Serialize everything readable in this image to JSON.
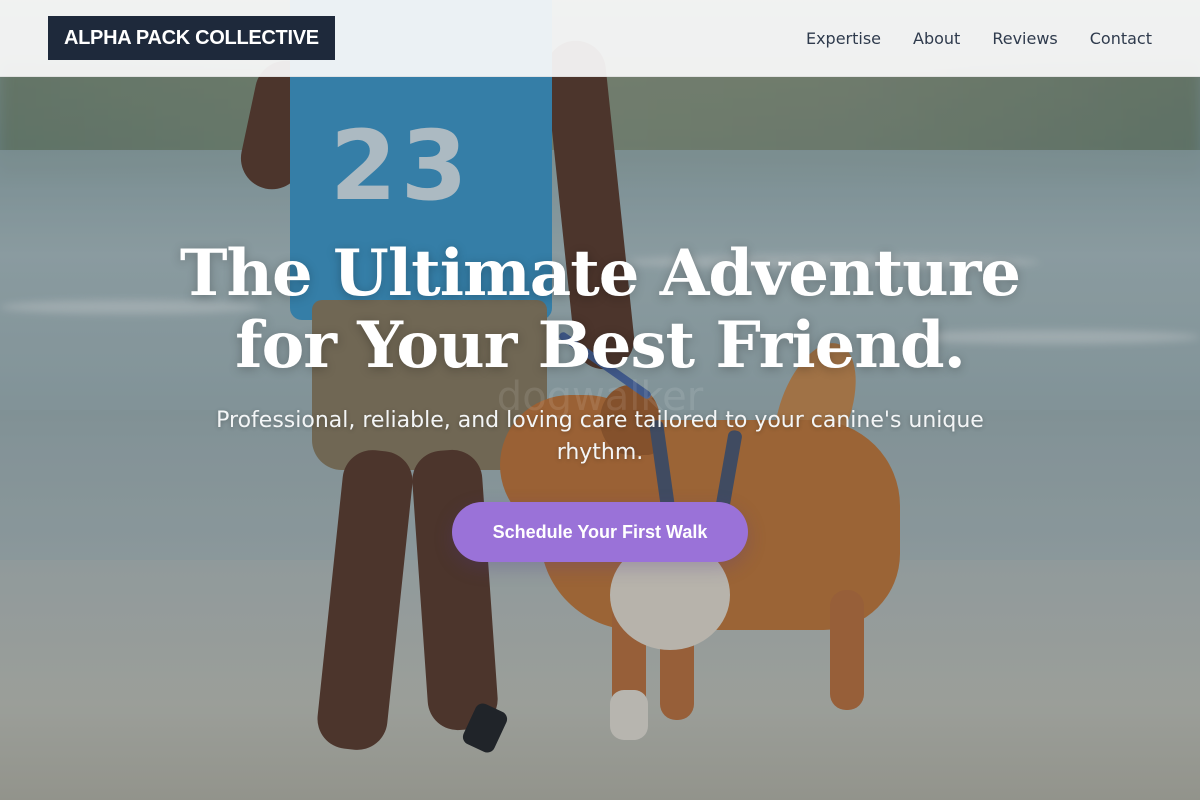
{
  "header": {
    "logo": "ALPHA PACK COLLECTIVE",
    "nav": [
      "Expertise",
      "About",
      "Reviews",
      "Contact"
    ]
  },
  "hero": {
    "headline_line1": "The Ultimate Adventure",
    "headline_line2": "for Your Best Friend.",
    "watermark": "dogwalker",
    "subheadline": "Professional, reliable, and loving care tailored to your canine's unique rhythm.",
    "cta_label": "Schedule Your First Walk",
    "jersey_text": "23",
    "image_content": "person walking dog on beach"
  },
  "colors": {
    "logo_bg": "#1e293b",
    "cta_bg": "#9a72d8",
    "nav_text": "#2f3b4d"
  }
}
